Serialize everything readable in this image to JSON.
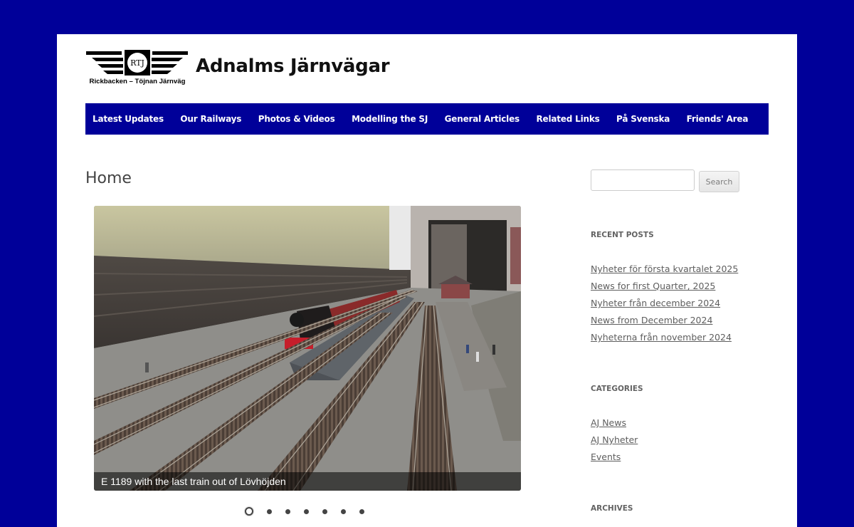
{
  "header": {
    "site_title": "Adnalms Järnvägar",
    "logo_initials": "RTJ",
    "logo_subtitle": "Rickbacken – Töjnan Järnväg"
  },
  "nav": {
    "items": [
      "Latest Updates",
      "Our Railways",
      "Photos & Videos",
      "Modelling the SJ",
      "General Articles",
      "Related Links",
      "På Svenska",
      "Friends' Area"
    ]
  },
  "main": {
    "page_title": "Home",
    "slideshow": {
      "caption": "E 1189 with the last train out of Lövhöjden",
      "slide_count": 7,
      "active_index": 0
    }
  },
  "sidebar": {
    "search": {
      "value": "",
      "button_label": "Search"
    },
    "recent_posts": {
      "title": "RECENT POSTS",
      "items": [
        "Nyheter för första kvartalet 2025",
        "News for first Quarter, 2025",
        "Nyheter från december 2024",
        "News from December 2024",
        "Nyheterna från november 2024"
      ]
    },
    "categories": {
      "title": "CATEGORIES",
      "items": [
        "AJ News",
        "AJ Nyheter",
        "Events"
      ]
    },
    "archives": {
      "title": "ARCHIVES"
    }
  },
  "colors": {
    "background": "#000099",
    "nav": "#000099",
    "page": "#ffffff"
  }
}
